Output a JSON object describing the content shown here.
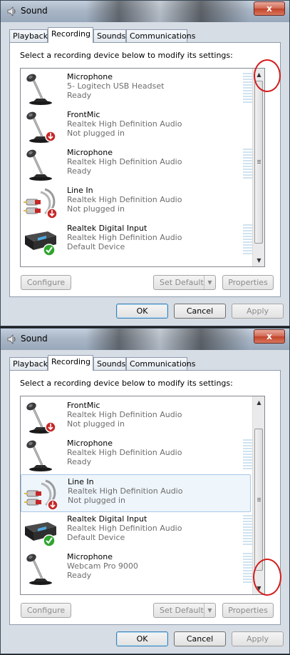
{
  "windows": [
    {
      "title": "Sound",
      "close_label": "x",
      "tabs": [
        "Playback",
        "Recording",
        "Sounds",
        "Communications"
      ],
      "instructions": "Select a recording device below to modify its settings:",
      "devices": [
        {
          "name": "Microphone",
          "description": "5- Logitech USB Headset",
          "status": "Ready",
          "icon": "microphone-icon"
        },
        {
          "name": "FrontMic",
          "description": "Realtek High Definition Audio",
          "status": "Not plugged in",
          "icon": "microphone-unplugged-icon"
        },
        {
          "name": "Microphone",
          "description": "Realtek High Definition Audio",
          "status": "Ready",
          "icon": "microphone-icon"
        },
        {
          "name": "Line In",
          "description": "Realtek High Definition Audio",
          "status": "Not plugged in",
          "icon": "line-in-cable-icon"
        },
        {
          "name": "Realtek Digital Input",
          "description": "Realtek High Definition Audio",
          "status": "Default Device",
          "icon": "digital-input-icon"
        }
      ],
      "scroll": "top",
      "buttons": {
        "configure": "Configure",
        "set_default": "Set Default",
        "properties": "Properties",
        "ok": "OK",
        "cancel": "Cancel",
        "apply": "Apply"
      }
    },
    {
      "title": "Sound",
      "close_label": "x",
      "tabs": [
        "Playback",
        "Recording",
        "Sounds",
        "Communications"
      ],
      "instructions": "Select a recording device below to modify its settings:",
      "devices": [
        {
          "name": "FrontMic",
          "description": "Realtek High Definition Audio",
          "status": "Not plugged in",
          "icon": "microphone-unplugged-icon"
        },
        {
          "name": "Microphone",
          "description": "Realtek High Definition Audio",
          "status": "Ready",
          "icon": "microphone-icon"
        },
        {
          "name": "Line In",
          "description": "Realtek High Definition Audio",
          "status": "Not plugged in",
          "icon": "line-in-cable-icon",
          "selected": true
        },
        {
          "name": "Realtek Digital Input",
          "description": "Realtek High Definition Audio",
          "status": "Default Device",
          "icon": "digital-input-icon"
        },
        {
          "name": "Microphone",
          "description": "Webcam Pro 9000",
          "status": "Ready",
          "icon": "microphone-icon"
        }
      ],
      "scroll": "bottom",
      "buttons": {
        "configure": "Configure",
        "set_default": "Set Default",
        "properties": "Properties",
        "ok": "OK",
        "cancel": "Cancel",
        "apply": "Apply"
      }
    }
  ],
  "colors": {
    "annotation_circle": "#d21d1d",
    "selection": "#eef5fb",
    "default_check": "#2fa52f",
    "unplugged_badge": "#c62828"
  }
}
